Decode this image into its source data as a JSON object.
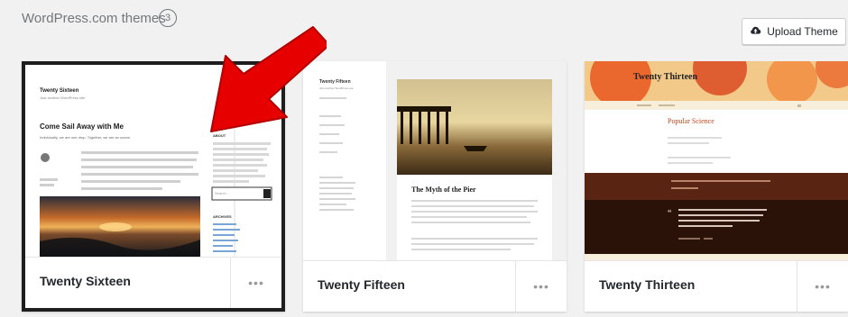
{
  "header": {
    "title": "WordPress.com themes",
    "count": "3"
  },
  "upload_button": {
    "label": "Upload Theme",
    "icon": "cloud-upload-icon"
  },
  "themes": [
    {
      "name": "Twenty Sixteen",
      "more_label": "•••",
      "preview": {
        "site_title": "Twenty Sixteen",
        "tagline": "Just another WordPress site",
        "post_title": "Come Sail Away with Me",
        "post_intro": "Individually, we are one drop. Together, we are an ocean.",
        "sidebar_title": "ABOUT",
        "search_placeholder": "Search ...",
        "archives_title": "ARCHIVES"
      }
    },
    {
      "name": "Twenty Fifteen",
      "more_label": "•••",
      "preview": {
        "site_title": "Twenty Fifteen",
        "tagline": "Just another WordPress site",
        "post_title": "The Myth of the Pier"
      }
    },
    {
      "name": "Twenty Thirteen",
      "more_label": "•••",
      "preview": {
        "site_title": "Twenty Thirteen",
        "post_title": "Popular Science"
      }
    }
  ],
  "colors": {
    "annotation_arrow": "#e60000",
    "active_border": "#1e1e1e",
    "thirteen_brown": "#5a2412",
    "thirteen_dark": "#2a1208",
    "thirteen_orange": "#e8571d"
  }
}
